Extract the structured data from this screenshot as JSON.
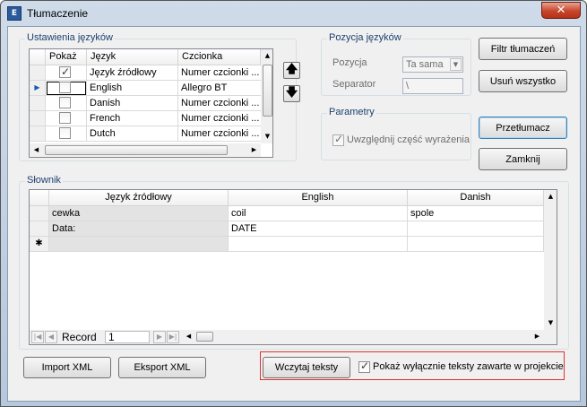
{
  "window": {
    "title": "Tłumaczenie",
    "app_icon_text": "E",
    "close_glyph": "✕"
  },
  "language_settings": {
    "group_label": "Ustawienia języków",
    "columns": [
      "Pokaż",
      "Język",
      "Czcionka"
    ],
    "rows": [
      {
        "show": true,
        "language": "Język źródłowy",
        "font": "Numer czcionki ...",
        "current": false
      },
      {
        "show": false,
        "language": "English",
        "font": "Allegro BT",
        "current": true
      },
      {
        "show": false,
        "language": "Danish",
        "font": "Numer czcionki ...",
        "current": false
      },
      {
        "show": false,
        "language": "French",
        "font": "Numer czcionki ...",
        "current": false
      },
      {
        "show": false,
        "language": "Dutch",
        "font": "Numer czcionki ...",
        "current": false
      }
    ],
    "move_up_glyph": "🡅",
    "move_down_glyph": "🡇"
  },
  "language_position": {
    "group_label": "Pozycja języków",
    "position_label": "Pozycja",
    "position_value": "Ta sama",
    "separator_label": "Separator",
    "separator_value": "\\"
  },
  "parameters": {
    "group_label": "Parametry",
    "include_part_label": "Uwzględnij część wyrażenia",
    "include_part_checked": true
  },
  "actions": {
    "filter_label": "Filtr tłumaczeń",
    "remove_all_label": "Usuń wszystko",
    "translate_label": "Przetłumacz",
    "close_label": "Zamknij"
  },
  "dictionary": {
    "group_label": "Słownik",
    "columns": [
      "Język źródłowy",
      "English",
      "Danish"
    ],
    "rows": [
      [
        "cewka",
        "coil",
        "spole"
      ],
      [
        "Data:",
        "DATE",
        ""
      ]
    ],
    "new_row_glyph": "✱",
    "record_label": "Record",
    "record_value": "1"
  },
  "footer": {
    "import_label": "Import XML",
    "export_label": "Eksport XML",
    "load_texts_label": "Wczytaj teksty",
    "project_only_label": "Pokaż wyłącznie teksty zawarte w projekcie",
    "project_only_checked": true
  },
  "colors": {
    "accent_border": "#3c7fb1",
    "highlight_border": "#e03030"
  }
}
